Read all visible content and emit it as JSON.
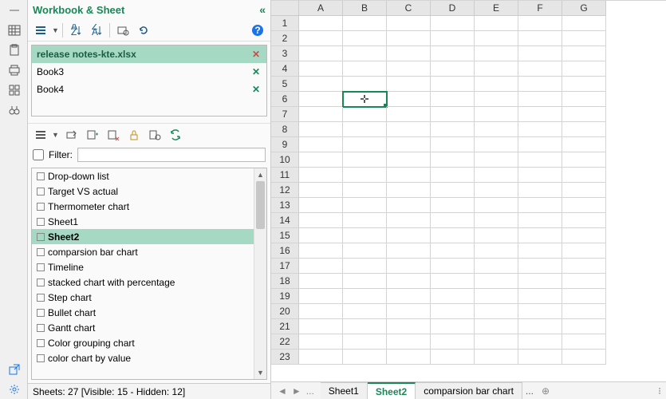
{
  "panel": {
    "title": "Workbook & Sheet",
    "collapse_glyph": "«",
    "help_glyph": "?"
  },
  "workbooks": [
    {
      "name": "release notes-kte.xlsx",
      "active": true
    },
    {
      "name": "Book3",
      "active": false
    },
    {
      "name": "Book4",
      "active": false
    }
  ],
  "filter": {
    "label": "Filter:",
    "value": ""
  },
  "sheets": [
    {
      "name": "Drop-down list",
      "selected": false
    },
    {
      "name": "Target VS actual",
      "selected": false
    },
    {
      "name": "Thermometer chart",
      "selected": false
    },
    {
      "name": "Sheet1",
      "selected": false
    },
    {
      "name": "Sheet2",
      "selected": true
    },
    {
      "name": "comparsion bar chart",
      "selected": false
    },
    {
      "name": "Timeline",
      "selected": false
    },
    {
      "name": "stacked chart with percentage",
      "selected": false
    },
    {
      "name": "Step chart",
      "selected": false
    },
    {
      "name": "Bullet chart",
      "selected": false
    },
    {
      "name": "Gantt chart",
      "selected": false
    },
    {
      "name": "Color grouping chart",
      "selected": false
    },
    {
      "name": "color chart by value",
      "selected": false
    }
  ],
  "status": {
    "text": "Sheets: 27  [Visible: 15 - Hidden: 12]"
  },
  "grid": {
    "columns": [
      "A",
      "B",
      "C",
      "D",
      "E",
      "F",
      "G"
    ],
    "rows": [
      "1",
      "2",
      "3",
      "4",
      "5",
      "6",
      "7",
      "8",
      "9",
      "10",
      "11",
      "12",
      "13",
      "14",
      "15",
      "16",
      "17",
      "18",
      "19",
      "20",
      "21",
      "22",
      "23"
    ],
    "active_cell": {
      "col": "B",
      "row": "6"
    }
  },
  "tabs": {
    "items": [
      {
        "label": "Sheet1",
        "active": false
      },
      {
        "label": "Sheet2",
        "active": true
      },
      {
        "label": "comparsion bar chart",
        "active": false
      }
    ],
    "ellipsis": "...",
    "nav_left": "◄",
    "nav_right": "►",
    "add_glyph": "⊕",
    "vdots_glyph": "⁝"
  }
}
